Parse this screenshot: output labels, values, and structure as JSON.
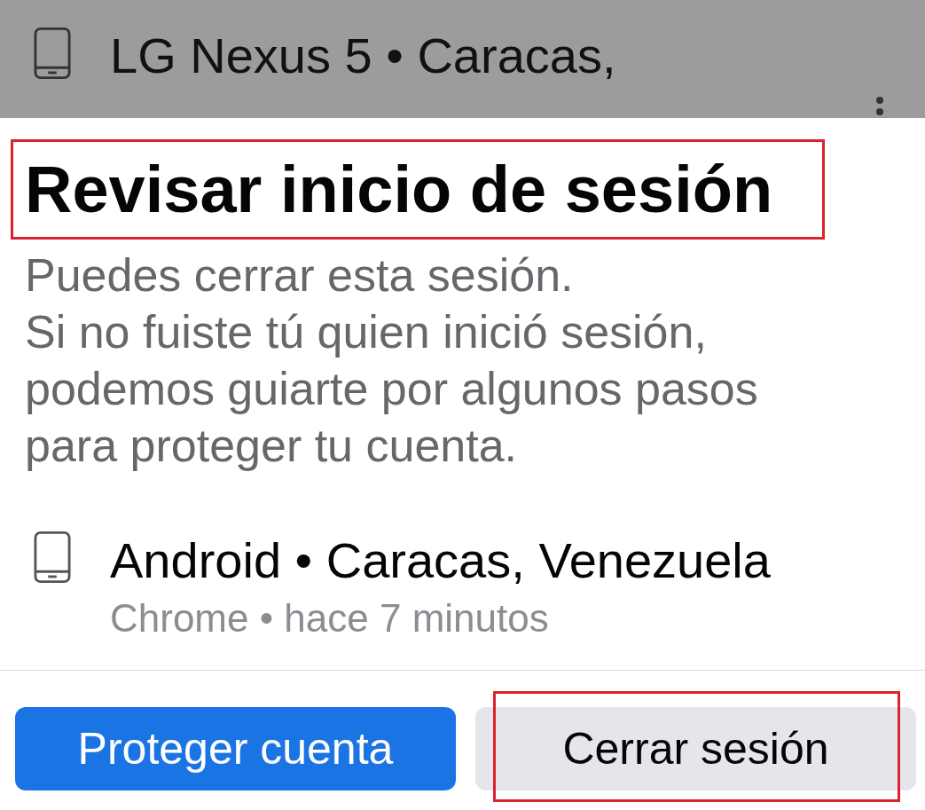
{
  "background_session": {
    "title": "LG Nexus 5 • Caracas,"
  },
  "sheet": {
    "title": "Revisar inicio de sesión",
    "title_highlighted": true,
    "description": [
      "Puedes cerrar esta sesión.",
      "Si no fuiste tú quien inició sesión,",
      "podemos guiarte por algunos pasos",
      "para proteger tu cuenta."
    ],
    "session": {
      "device": "Android • Caracas, Venezuela",
      "detail": "Chrome • hace 7 minutos"
    },
    "buttons": [
      {
        "label": "Proteger cuenta",
        "kind": "primary",
        "highlighted": false
      },
      {
        "label": "Cerrar sesión",
        "kind": "secondary",
        "highlighted": true
      }
    ]
  }
}
